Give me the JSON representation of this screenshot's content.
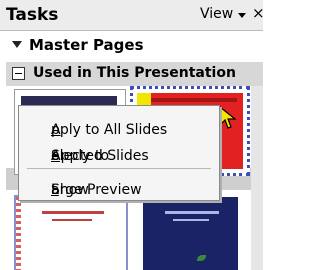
{
  "tasks_pane": {
    "title": "Tasks",
    "view_menu_label": "View",
    "close_glyph": "×",
    "view_arrow_icon": "triangle-down-icon"
  },
  "master_pages": {
    "label": "Master Pages",
    "expanded": true,
    "toggle_icon": "triangle-down-icon"
  },
  "used_section": {
    "label": "Used in This Presentation",
    "expanded": true,
    "toggle_icon": "collapse-minus-icon"
  },
  "context_menu": {
    "apply_all": {
      "before": "",
      "mnemonic": "A",
      "after": "pply to All Slides"
    },
    "apply_selected": {
      "before": "Apply to ",
      "mnemonic": "S",
      "after": "elected Slides"
    },
    "large_preview": {
      "before": "Show ",
      "mnemonic": "L",
      "after": "arge Preview"
    }
  },
  "colors": {
    "selection_border": "#3c4fb8",
    "red_master": "#e22222",
    "yellow_stripe": "#f2e600",
    "navy_master": "#1a2366"
  }
}
